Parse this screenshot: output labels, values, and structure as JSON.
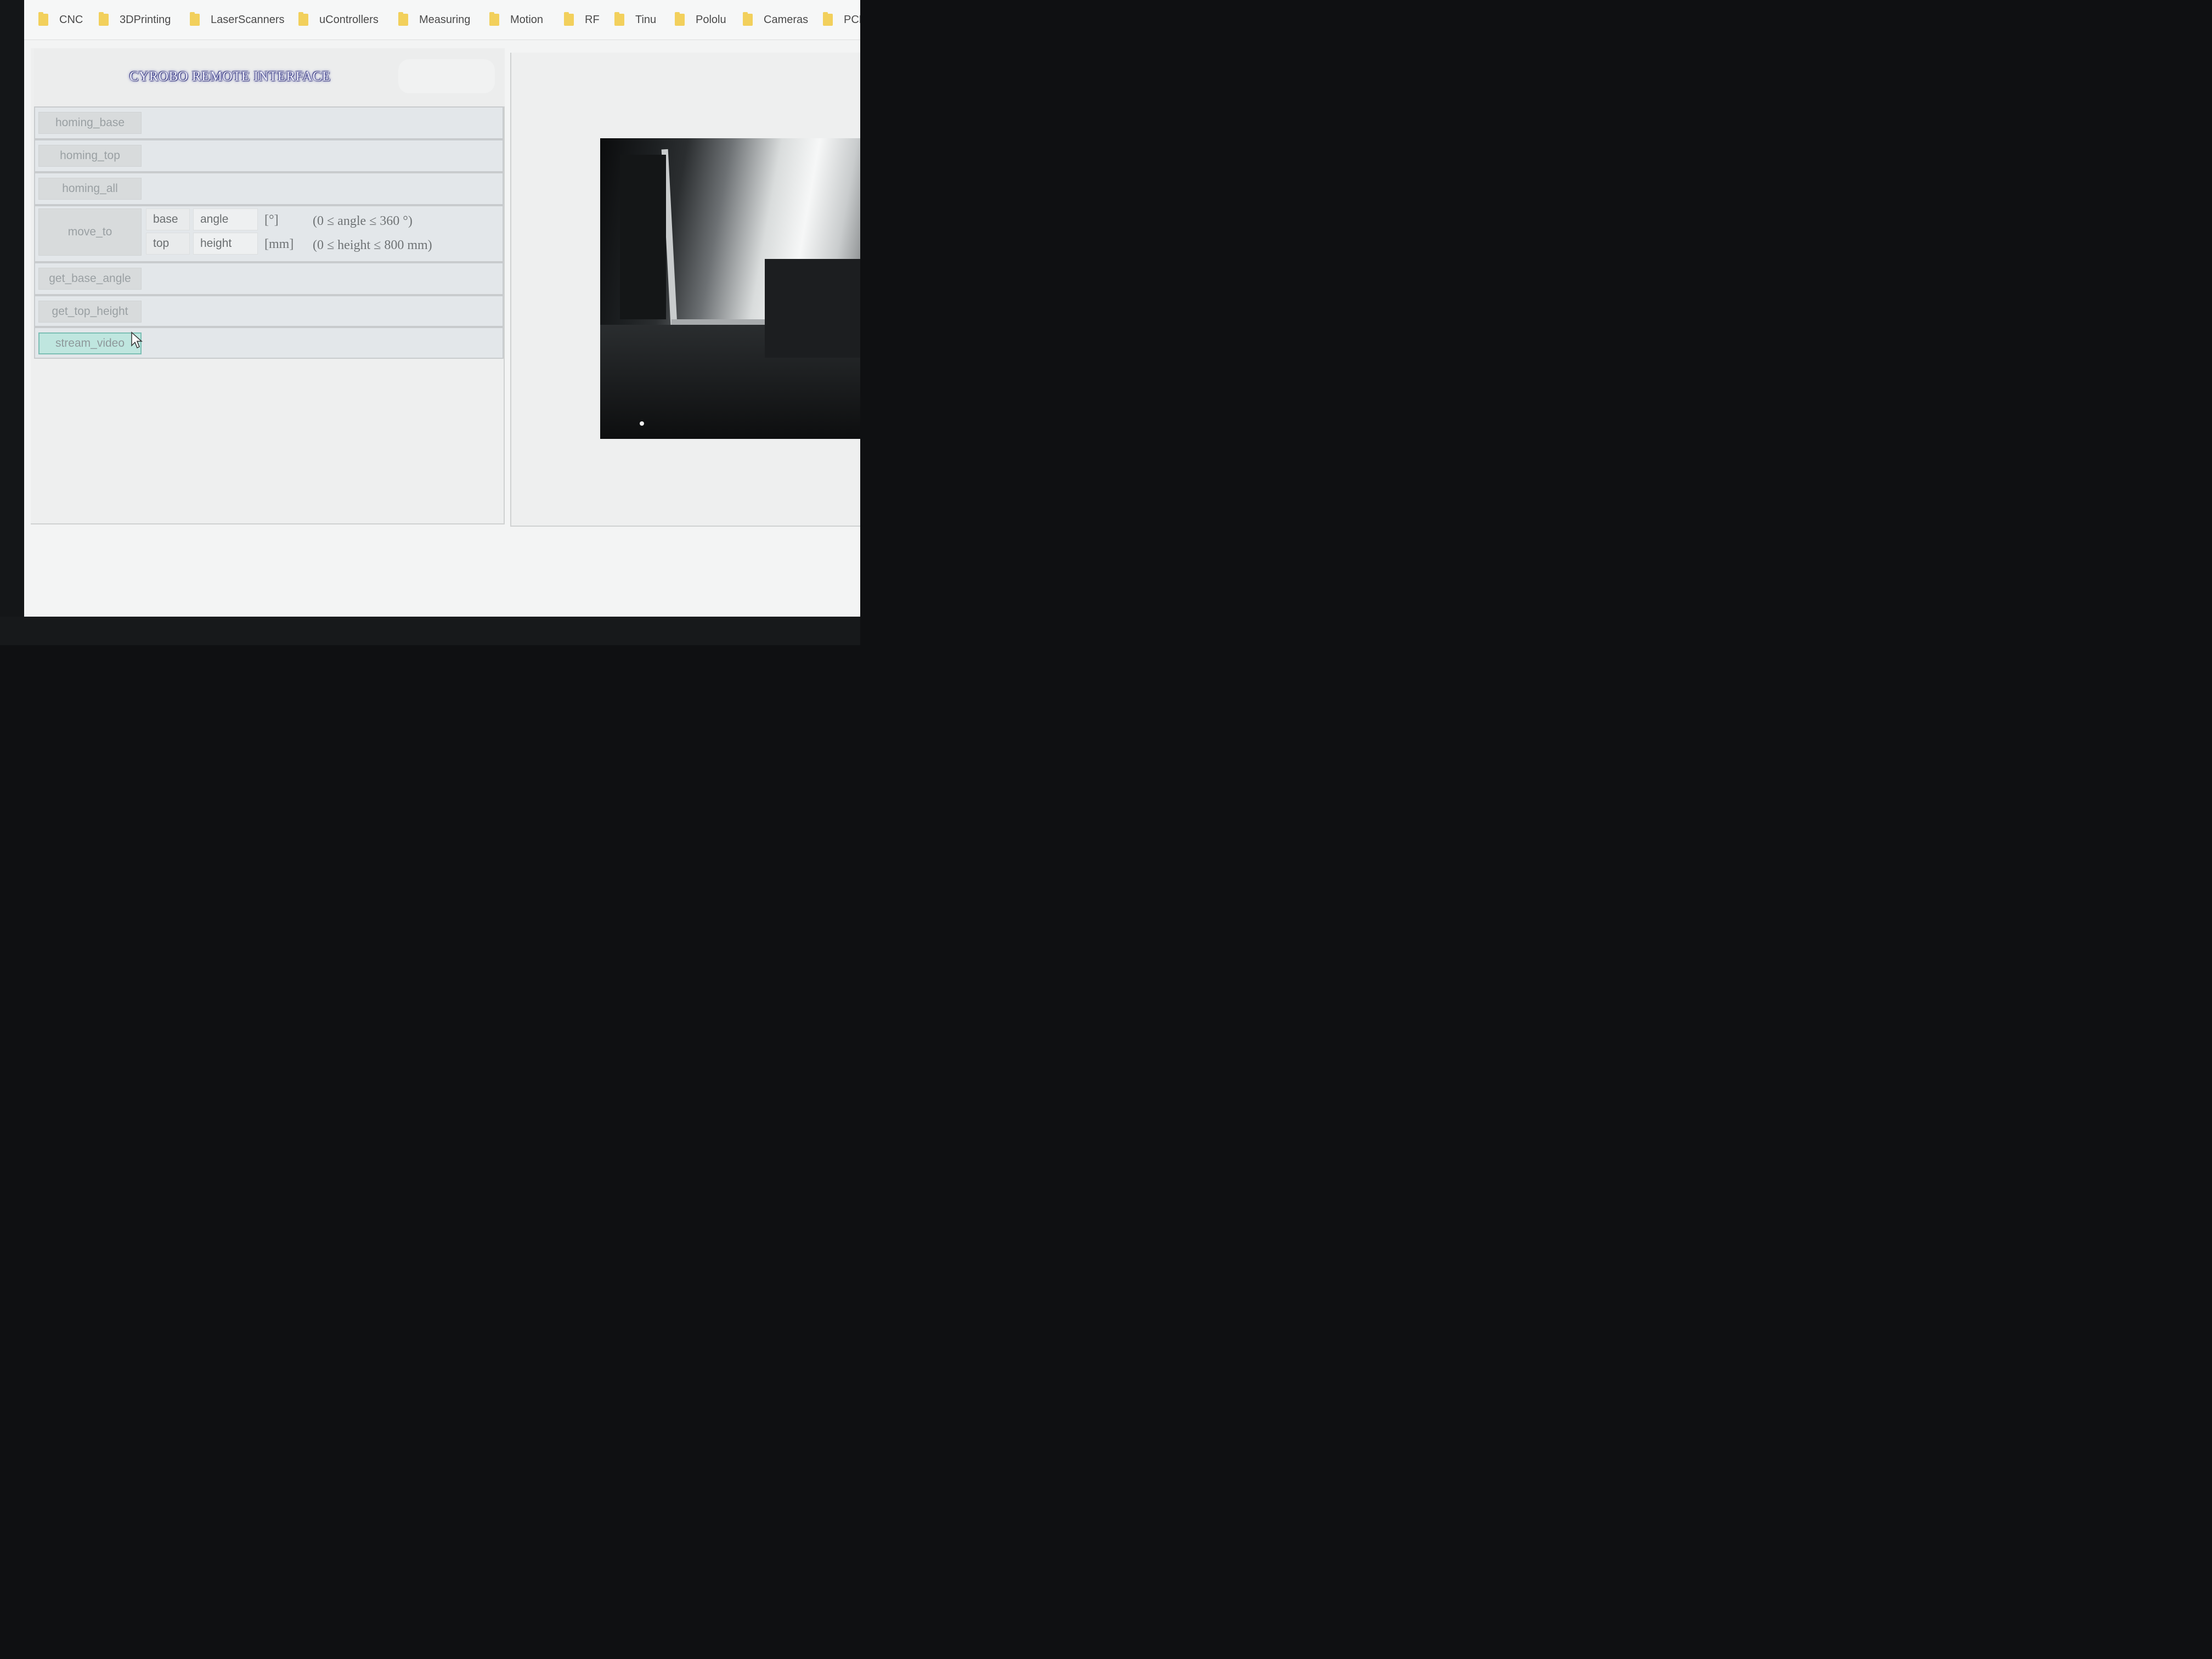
{
  "bookmarks": [
    "CNC",
    "3DPrinting",
    "LaserScanners",
    "uControllers",
    "Measuring",
    "Motion",
    "RF",
    "Tinu",
    "Pololu",
    "Cameras",
    "PCB"
  ],
  "app": {
    "title": "CYROBO REMOTE INTERFACE"
  },
  "commands": {
    "homing_base": "homing_base",
    "homing_top": "homing_top",
    "homing_all": "homing_all",
    "move_to": "move_to",
    "get_base_angle": "get_base_angle",
    "get_top_height": "get_top_height",
    "stream_video": "stream_video"
  },
  "move_to": {
    "base": {
      "axis": "base",
      "field": "angle",
      "unit": "[°]",
      "range": "(0 ≤ angle ≤ 360 °)"
    },
    "top": {
      "axis": "top",
      "field": "height",
      "unit": "[mm]",
      "range": "(0 ≤ height ≤ 800 mm)"
    }
  },
  "colors": {
    "active_button": "#bfe6df",
    "folder": "#f2d05c",
    "title_glow": "#4a4da8"
  },
  "icons": {
    "bookmark": "folder-icon",
    "pointer": "mouse-cursor-icon"
  }
}
